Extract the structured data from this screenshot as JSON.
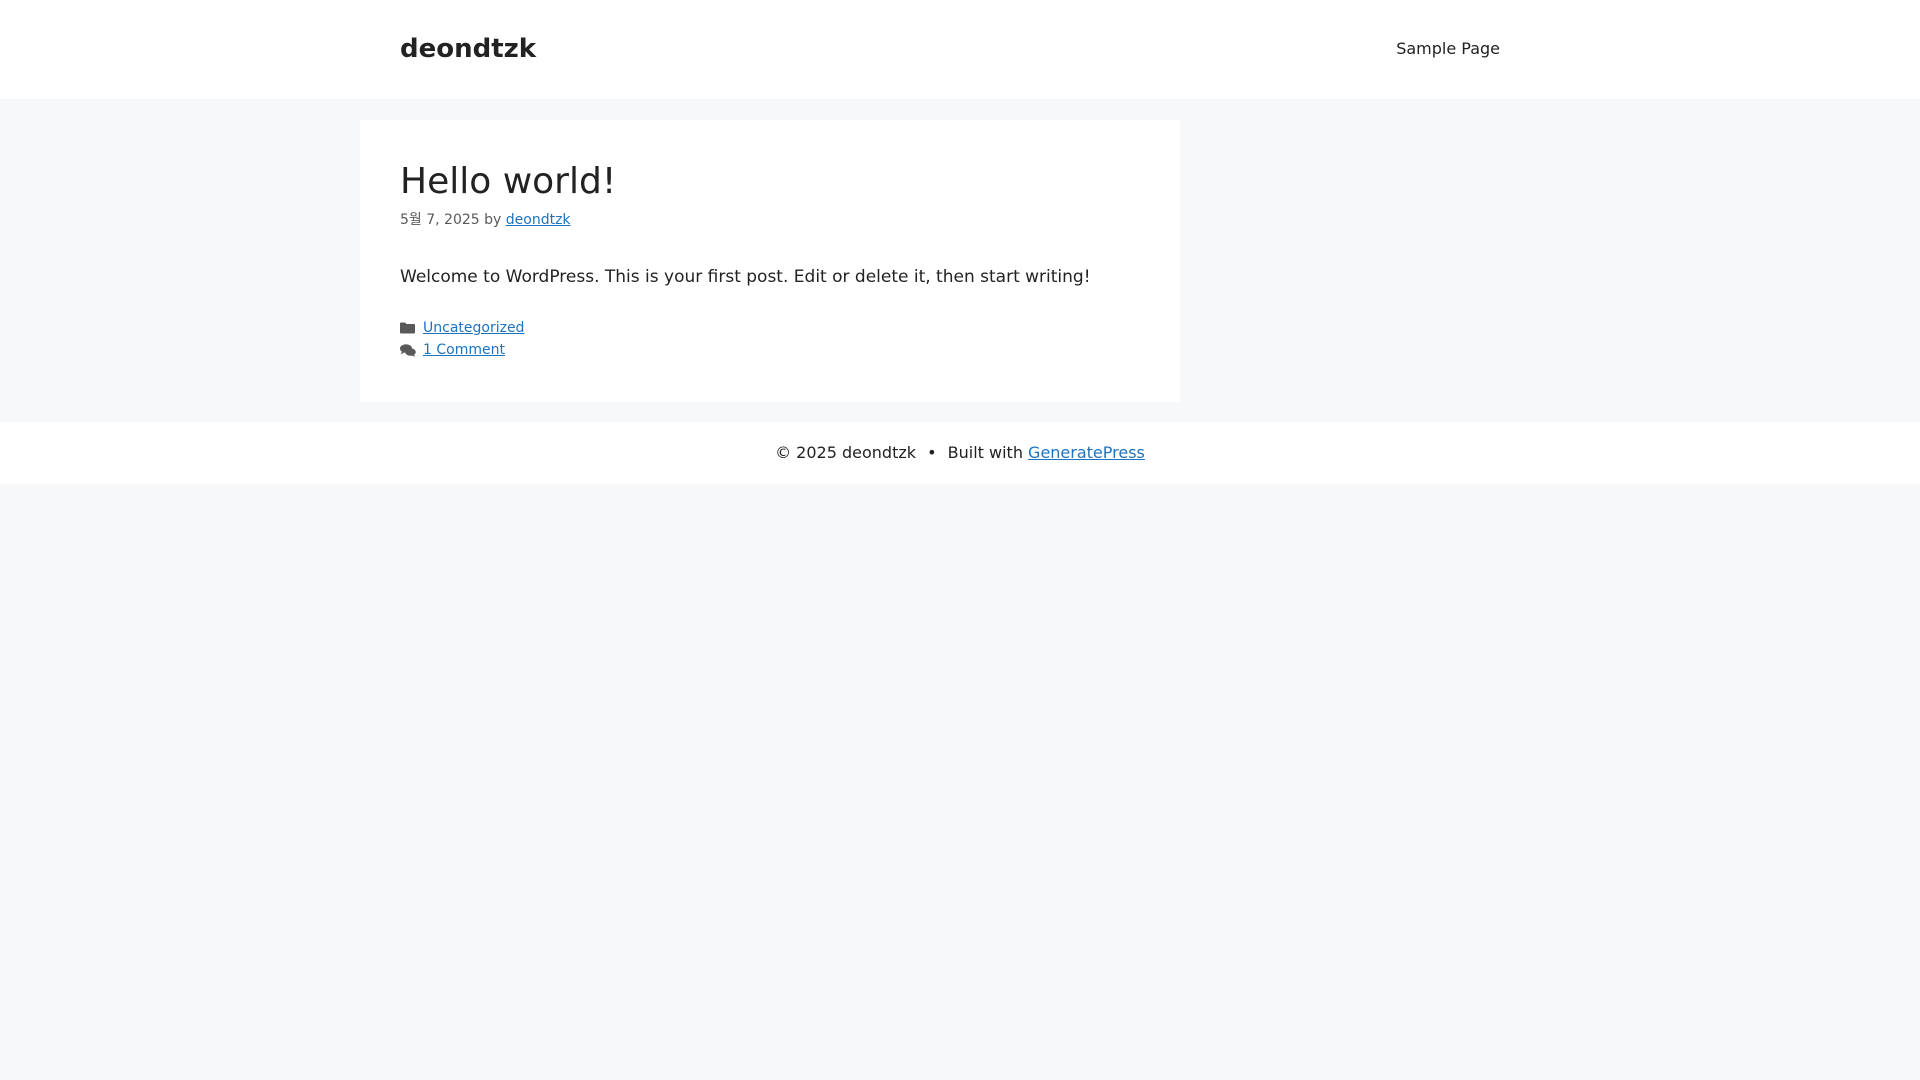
{
  "header": {
    "site_title": "deondtzk",
    "nav": [
      {
        "label": "Sample Page"
      }
    ]
  },
  "post": {
    "title": "Hello world!",
    "date": "5월 7, 2025",
    "by_label": "by",
    "author": "deondtzk",
    "excerpt": "Welcome to WordPress. This is your first post. Edit or delete it, then start writing!",
    "category": "Uncategorized",
    "comments": "1 Comment"
  },
  "footer": {
    "copyright": "© 2025 deondtzk",
    "bullet": "•",
    "built_with": "Built with",
    "theme_link": "GeneratePress"
  },
  "colors": {
    "background": "#f7f8f9",
    "link": "#1e73be",
    "text": "#222222",
    "meta_text": "#595959",
    "icon": "#595959"
  },
  "icons": {
    "category": "folder-icon",
    "comments": "comments-icon"
  }
}
